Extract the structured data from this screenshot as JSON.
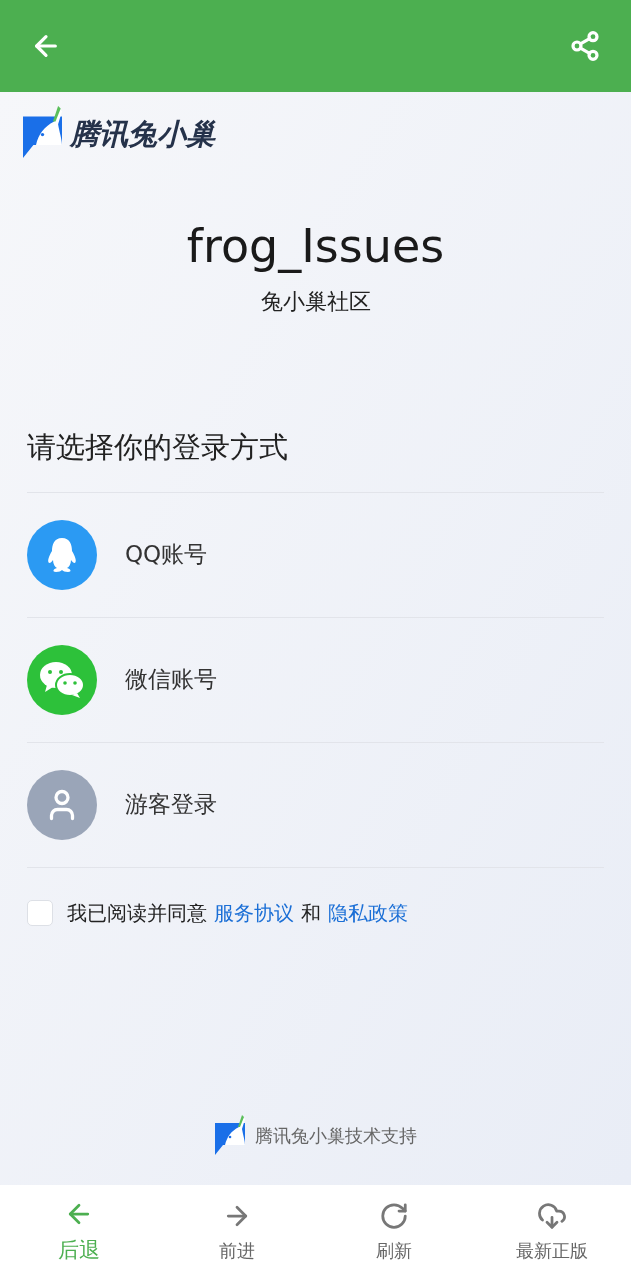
{
  "brand": {
    "name": "腾讯兔小巢"
  },
  "community": {
    "title": "frog_Issues",
    "subtitle": "兔小巢社区"
  },
  "login": {
    "heading": "请选择你的登录方式",
    "options": [
      {
        "kind": "qq",
        "label": "QQ账号"
      },
      {
        "kind": "wechat",
        "label": "微信账号"
      },
      {
        "kind": "guest",
        "label": "游客登录"
      }
    ]
  },
  "agreement": {
    "checked": false,
    "text": "我已阅读并同意",
    "link_1": "服务协议",
    "joiner": "和",
    "link_2": "隐私政策"
  },
  "footer": {
    "text": "腾讯兔小巢技术支持"
  },
  "bottom_nav": [
    {
      "kind": "back",
      "label": "后退",
      "selected": true
    },
    {
      "kind": "forward",
      "label": "前进",
      "selected": false
    },
    {
      "kind": "refresh",
      "label": "刷新",
      "selected": false
    },
    {
      "kind": "download",
      "label": "最新正版",
      "selected": false
    }
  ]
}
